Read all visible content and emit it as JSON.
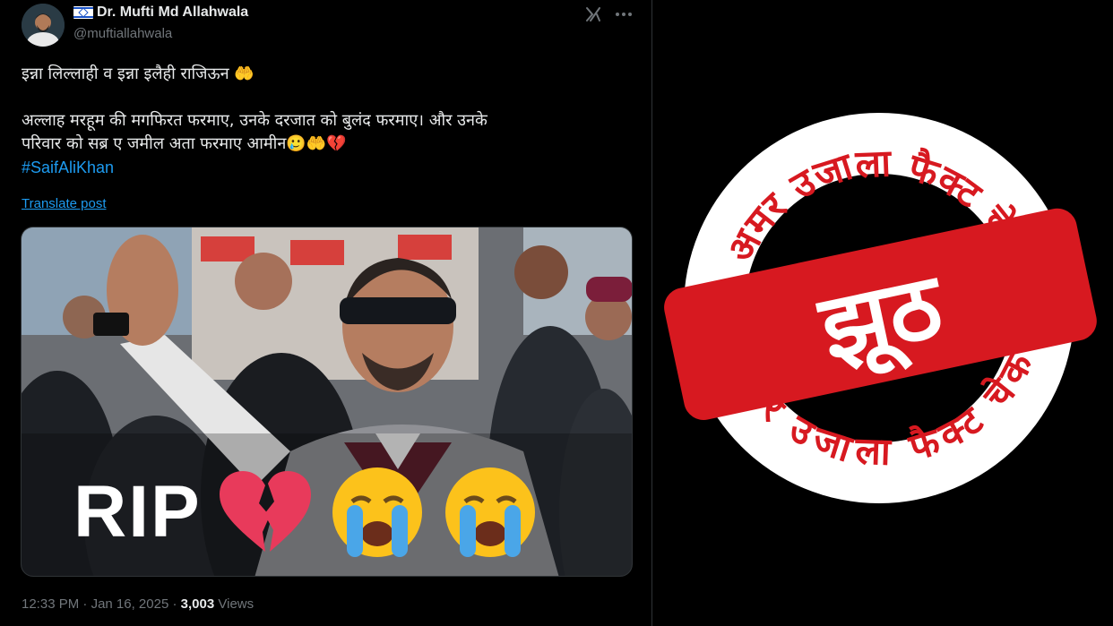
{
  "tweet": {
    "display_name": "Dr. Mufti Md Allahwala",
    "handle": "@muftiallahwala",
    "lines": [
      "इन्ना लिल्लाही व इन्ना इलैही राजिऊन 🤲",
      "",
      "अल्लाह मरहूम की मगफिरत फरमाए, उनके दरजात को बुलंद फरमाए। और उनके",
      "परिवार को सब्र ए जमील अता फरमाए आमीन🥲🤲💔"
    ],
    "hashtag": "#SaifAliKhan",
    "translate_label": "Translate post",
    "time": "12:33 PM",
    "separator": "·",
    "date": "Jan 16, 2025",
    "views_count": "3,003",
    "views_label": "Views"
  },
  "media": {
    "overlay_text": "RIP"
  },
  "stamp": {
    "arc_text": "अमर उजाला फैक्ट चेक",
    "verdict": "झूठ",
    "color": "#d71920"
  },
  "icons": {
    "grok": "grok-icon",
    "more": "more-icon",
    "flag": "israel-flag-icon",
    "broken_heart": "broken-heart-icon",
    "crying_face": "crying-face-icon"
  },
  "colors": {
    "background": "#000000",
    "text": "#e7e9ea",
    "muted": "#71767b",
    "link": "#1d9bf0"
  }
}
